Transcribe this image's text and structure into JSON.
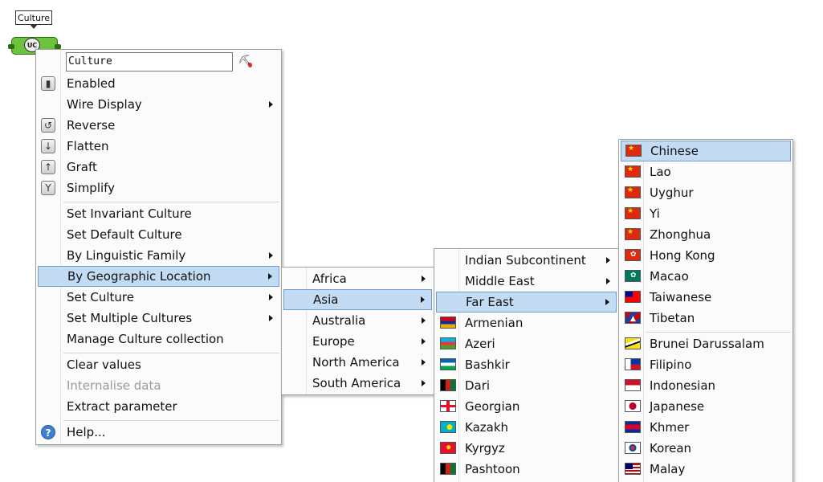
{
  "component": {
    "tooltip": "Culture",
    "icon_label": "UC"
  },
  "main_menu": {
    "name_field_value": "Culture",
    "paint_icon": "paintbrush-icon",
    "items": {
      "enabled": "Enabled",
      "wire_display": "Wire Display",
      "reverse": "Reverse",
      "flatten": "Flatten",
      "graft": "Graft",
      "simplify": "Simplify",
      "set_invariant": "Set Invariant Culture",
      "set_default": "Set Default Culture",
      "by_linguistic": "By Linguistic Family",
      "by_geographic": "By Geographic Location",
      "set_culture": "Set Culture",
      "set_multiple": "Set Multiple Cultures",
      "manage": "Manage Culture collection",
      "clear": "Clear values",
      "internalise": "Internalise data",
      "extract": "Extract parameter",
      "help": "Help..."
    }
  },
  "continents_menu": {
    "items": [
      "Africa",
      "Asia",
      "Australia",
      "Europe",
      "North America",
      "South America"
    ]
  },
  "asia_menu": {
    "regions": [
      "Indian Subcontinent",
      "Middle East",
      "Far East"
    ],
    "languages": [
      "Armenian",
      "Azeri",
      "Bashkir",
      "Dari",
      "Georgian",
      "Kazakh",
      "Kyrgyz",
      "Pashtoon"
    ]
  },
  "far_east_menu": {
    "group1": [
      "Chinese",
      "Lao",
      "Uyghur",
      "Yi",
      "Zhonghua",
      "Hong Kong",
      "Macao",
      "Taiwanese",
      "Tibetan"
    ],
    "group2": [
      "Brunei Darussalam",
      "Filipino",
      "Indonesian",
      "Japanese",
      "Khmer",
      "Korean",
      "Malay"
    ]
  },
  "colors": {
    "highlight": "#c3dcf4",
    "highlight_border": "#6e9ed3",
    "component_green": "#6cc33d"
  }
}
